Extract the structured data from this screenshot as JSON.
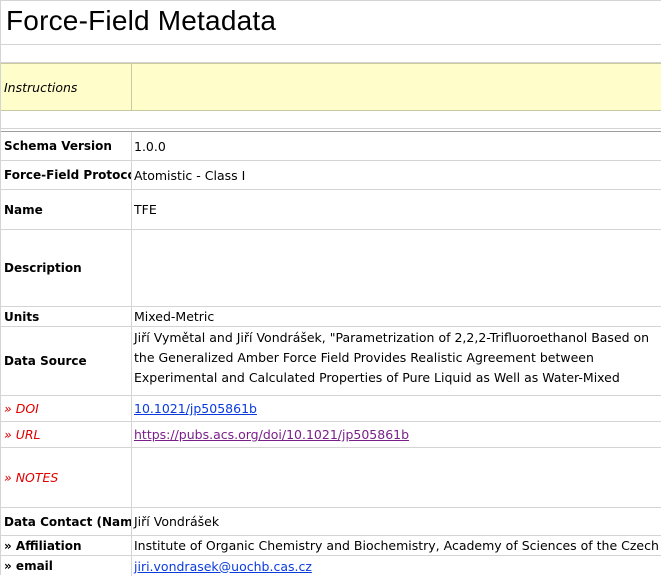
{
  "title": "Force-Field Metadata",
  "instructions_label": "Instructions",
  "instructions_value": "",
  "colors": {
    "instructions_fill": "#fffecb",
    "red_label": "#e00000",
    "link_blue": "#0a3bdc",
    "link_visited": "#7a1f8a",
    "gridline": "#d4d4d4"
  },
  "rows": {
    "schema_version": {
      "label": "Schema Version",
      "value": "1.0.0"
    },
    "protocol": {
      "label": "Force-Field Protocol",
      "value": "Atomistic - Class I"
    },
    "name": {
      "label": "Name",
      "value": "TFE"
    },
    "description": {
      "label": "Description",
      "value": ""
    },
    "units": {
      "label": "Units",
      "value": "Mixed-Metric"
    },
    "data_source": {
      "label": "Data Source",
      "value": "Jiří Vymětal and Jiří Vondrášek, \"Parametrization of 2,2,2-Trifluoroethanol Based on the Generalized Amber Force Field Provides Realistic Agreement between Experimental and Calculated Properties of Pure Liquid as Well as Water-Mixed"
    },
    "doi": {
      "label": "» DOI",
      "value": "10.1021/jp505861b"
    },
    "url": {
      "label": "» URL",
      "value": "https://pubs.acs.org/doi/10.1021/jp505861b"
    },
    "notes": {
      "label": "» NOTES",
      "value": ""
    },
    "data_contact": {
      "label": "Data Contact (Name)",
      "value": "Jiří Vondrášek"
    },
    "affiliation": {
      "label": "» Affiliation",
      "value": "Institute of Organic Chemistry and Biochemistry, Academy of Sciences of the Czech Re"
    },
    "email": {
      "label": "» email",
      "value": "jiri.vondrasek@uochb.cas.cz"
    }
  }
}
